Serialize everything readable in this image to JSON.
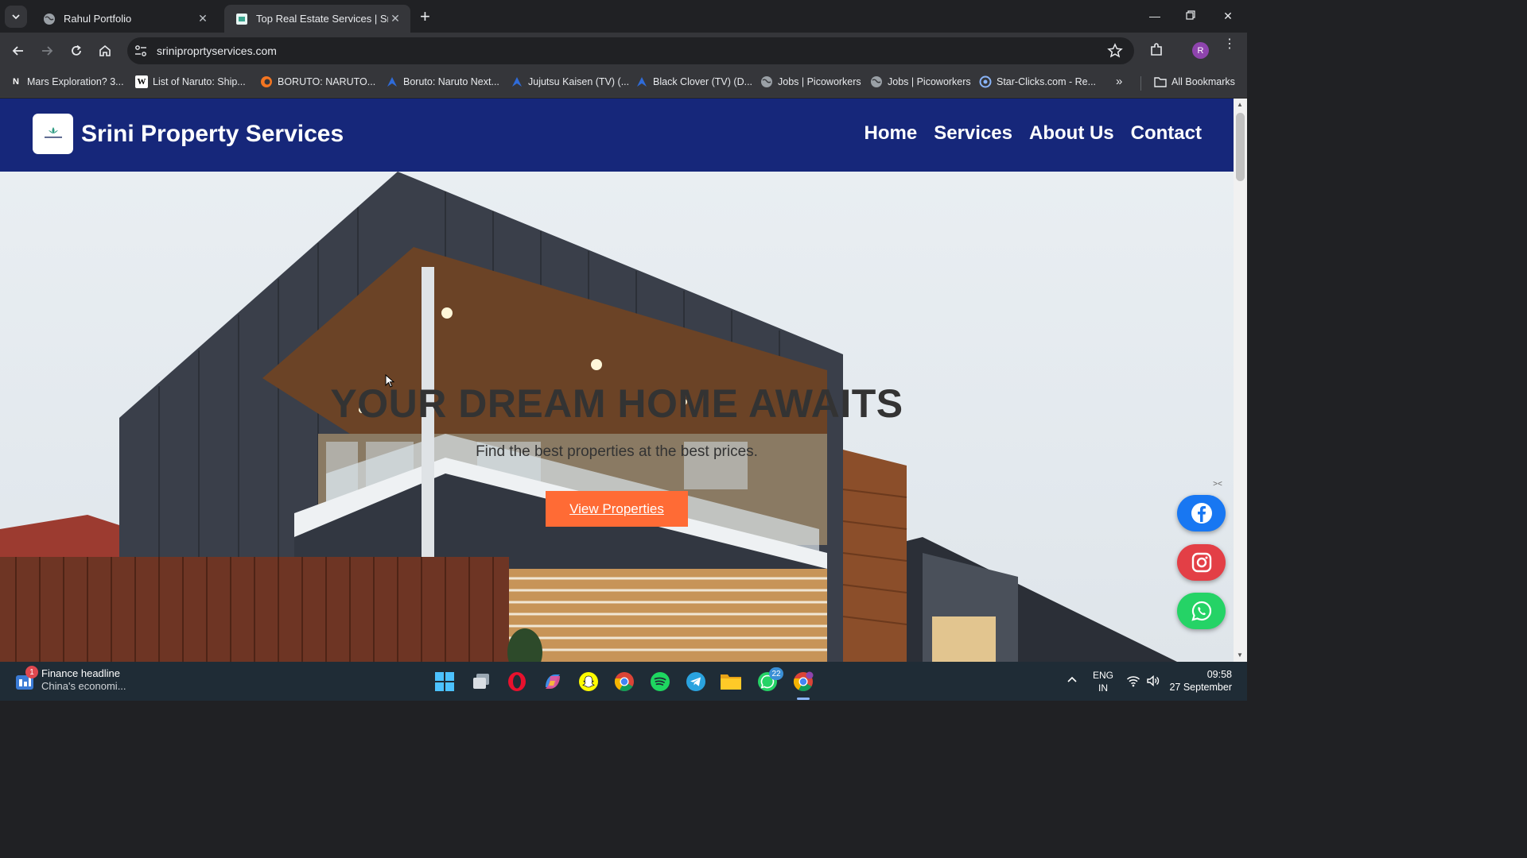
{
  "browser": {
    "tabs": [
      {
        "title": "Rahul Portfolio",
        "active": false
      },
      {
        "title": "Top Real Estate Services | Srini P",
        "active": true
      }
    ],
    "url": "sriniproprtyservices.com",
    "profile_initial": "R",
    "bookmarks": [
      {
        "label": "Mars Exploration? 3...",
        "icon": "notion-icon"
      },
      {
        "label": "List of Naruto: Ship...",
        "icon": "wikipedia-icon"
      },
      {
        "label": "BORUTO: NARUTO...",
        "icon": "crunchyroll-icon"
      },
      {
        "label": "Boruto: Naruto Next...",
        "icon": "anime-planet-icon"
      },
      {
        "label": "Jujutsu Kaisen (TV) (...",
        "icon": "anime-planet-icon"
      },
      {
        "label": "Black Clover (TV) (D...",
        "icon": "anime-planet-icon"
      },
      {
        "label": "Jobs | Picoworkers",
        "icon": "globe-icon"
      },
      {
        "label": "Jobs | Picoworkers",
        "icon": "globe-icon"
      },
      {
        "label": "Star-Clicks.com - Re...",
        "icon": "starclicks-icon"
      }
    ],
    "all_bookmarks_label": "All Bookmarks",
    "more_bookmarks_glyph": "»"
  },
  "site": {
    "brand": "Srini Property Services",
    "nav": [
      "Home",
      "Services",
      "About Us",
      "Contact"
    ],
    "hero": {
      "title": "YOUR DREAM HOME AWAITS",
      "subtitle": "Find the best properties at the best prices.",
      "cta": "View Properties"
    },
    "social": [
      "facebook-icon",
      "instagram-icon",
      "whatsapp-icon"
    ],
    "colors": {
      "header_bg": "#16277a",
      "cta_bg": "#ff6b35",
      "facebook": "#1877f2",
      "instagram": "#e33f46",
      "whatsapp": "#25d366"
    }
  },
  "taskbar": {
    "news_title": "Finance headline",
    "news_sub": "China's economi...",
    "news_badge": "1",
    "whatsapp_badge": "22",
    "lang_top": "ENG",
    "lang_bottom": "IN",
    "time": "09:58",
    "date": "27 September"
  }
}
